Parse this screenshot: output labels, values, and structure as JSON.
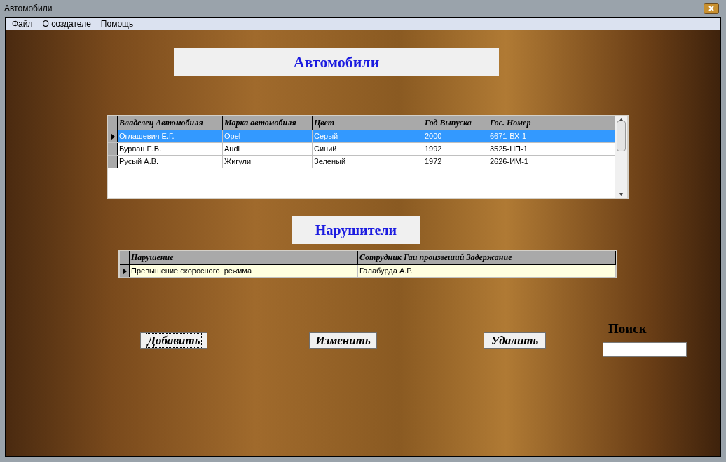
{
  "window": {
    "title": "Автомобили"
  },
  "menu": [
    {
      "label": "Файл"
    },
    {
      "label": "О создателе"
    },
    {
      "label": "Помощь"
    }
  ],
  "cars_title": "Автомобили",
  "cars_table": {
    "columns": [
      "Владелец Автомобиля",
      "Марка автомобиля",
      "Цвет",
      "Год Выпуска",
      "Гос. Номер"
    ],
    "rows": [
      {
        "cells": [
          "Оглашевич Е.Г.",
          "Opel",
          "Серый",
          "2000",
          "6671-ВХ-1"
        ],
        "selected": true
      },
      {
        "cells": [
          "Бурван Е.В.",
          "Audi",
          "Синий",
          "1992",
          "3525-НП-1"
        ],
        "selected": false
      },
      {
        "cells": [
          "Русый А.В.",
          "Жигули",
          "Зеленый",
          "1972",
          "2626-ИМ-1"
        ],
        "selected": false
      }
    ]
  },
  "violators_title": "Нарушители",
  "violations_table": {
    "columns": [
      "Нарушение",
      "Сотрудник Гаи произвеший Задержание"
    ],
    "rows": [
      {
        "cells": [
          "Превышение скоросного  режима",
          "Галабурда А.Р."
        ],
        "selected": true
      }
    ]
  },
  "buttons": [
    {
      "label": "Добавить",
      "focused": true
    },
    {
      "label": "Изменить",
      "focused": false
    },
    {
      "label": "Удалить",
      "focused": false
    }
  ],
  "search": {
    "label": "Поиск"
  }
}
